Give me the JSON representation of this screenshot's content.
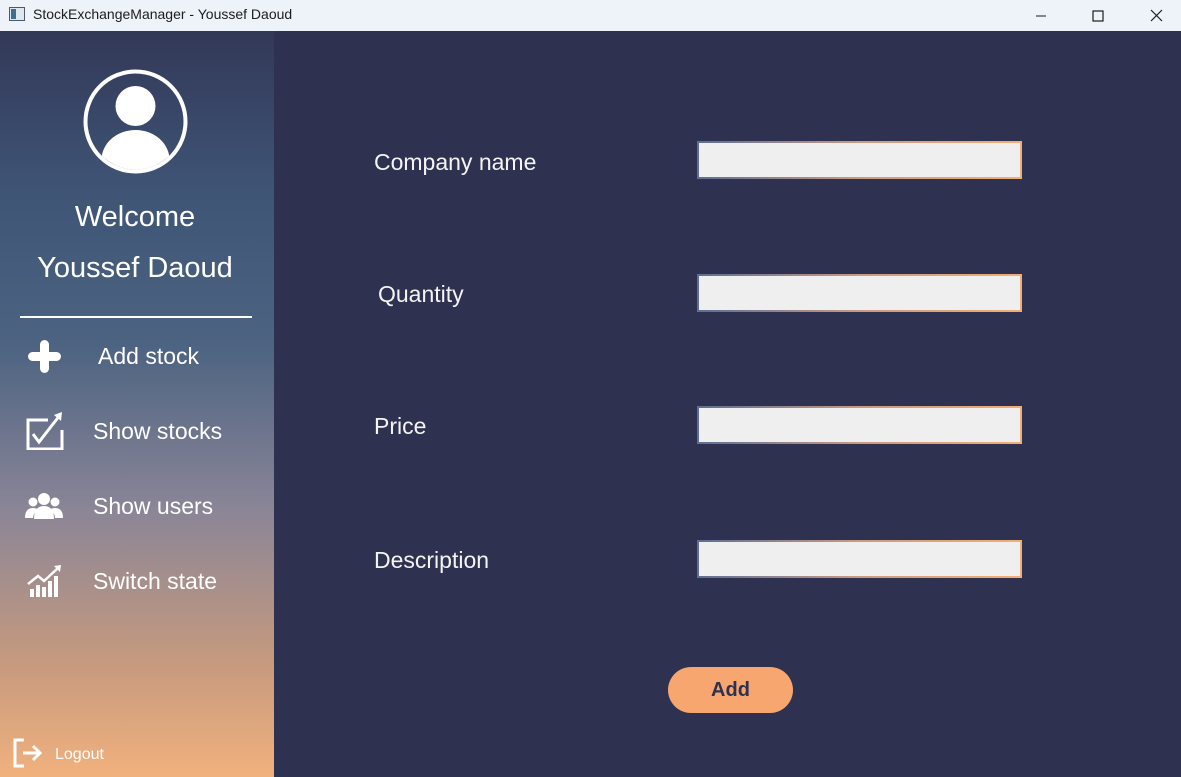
{
  "window": {
    "title": "StockExchangeManager - Youssef Daoud",
    "controls": [
      "minimize-icon",
      "maximize-icon",
      "close-icon"
    ]
  },
  "sidebar": {
    "avatar_icon": "user-circle-icon",
    "welcome": "Welcome",
    "username": "Youssef Daoud",
    "items": [
      {
        "label": "Add stock",
        "icon": "plus-icon"
      },
      {
        "label": "Show stocks",
        "icon": "chart-check-icon"
      },
      {
        "label": "Show users",
        "icon": "users-icon"
      },
      {
        "label": "Switch state",
        "icon": "growth-chart-icon"
      }
    ],
    "logout": {
      "label": "Logout",
      "icon": "logout-icon"
    }
  },
  "form": {
    "fields": [
      {
        "label": "Company name",
        "value": ""
      },
      {
        "label": "Quantity",
        "value": ""
      },
      {
        "label": "Price",
        "value": ""
      },
      {
        "label": "Description",
        "value": ""
      }
    ],
    "submit_label": "Add"
  },
  "colors": {
    "main_background": "#2e3150",
    "accent": "#f6a66e",
    "sidebar_top": "#333858",
    "sidebar_bottom": "#f1b17d"
  }
}
